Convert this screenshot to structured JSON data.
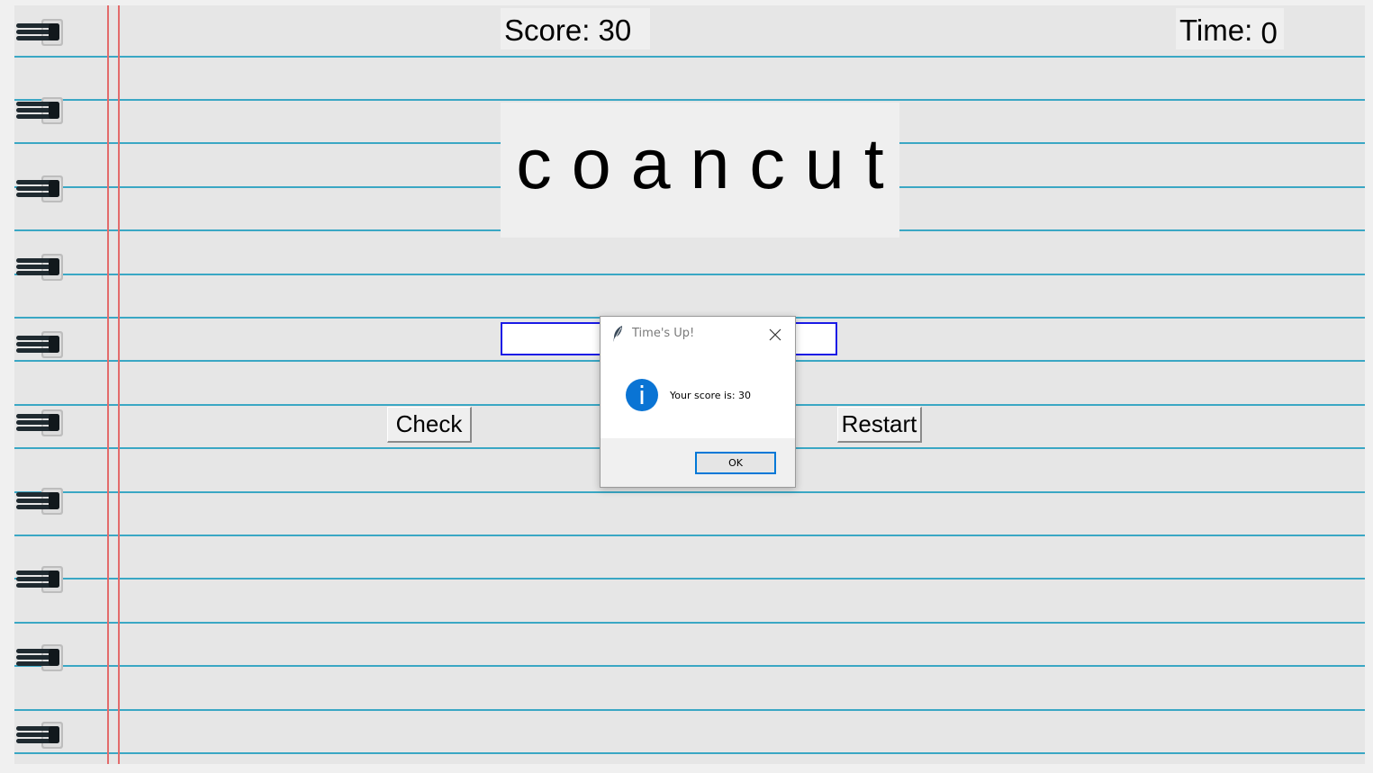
{
  "game": {
    "score_text": "Score: 30",
    "time_label": "Time: ",
    "time_value": "0",
    "scrambled_word": "c o a n c u t",
    "answer_value": "",
    "check_label": "Check",
    "restart_label": "Restart"
  },
  "dialog": {
    "title": "Time's Up!",
    "message": "Your score is: 30",
    "ok_label": "OK",
    "title_icon": "feather-icon",
    "message_icon": "info-icon",
    "close_icon": "close-icon"
  },
  "notebook": {
    "decor_icon": "binder-ring-icon",
    "rule_color": "#3aa7c4",
    "margin_color": "#e36b6b",
    "paper_color": "#e6e6e6"
  },
  "colors": {
    "input_border": "#1a1ae6",
    "ok_border": "#0078d7",
    "info_icon": "#0a74d4"
  }
}
